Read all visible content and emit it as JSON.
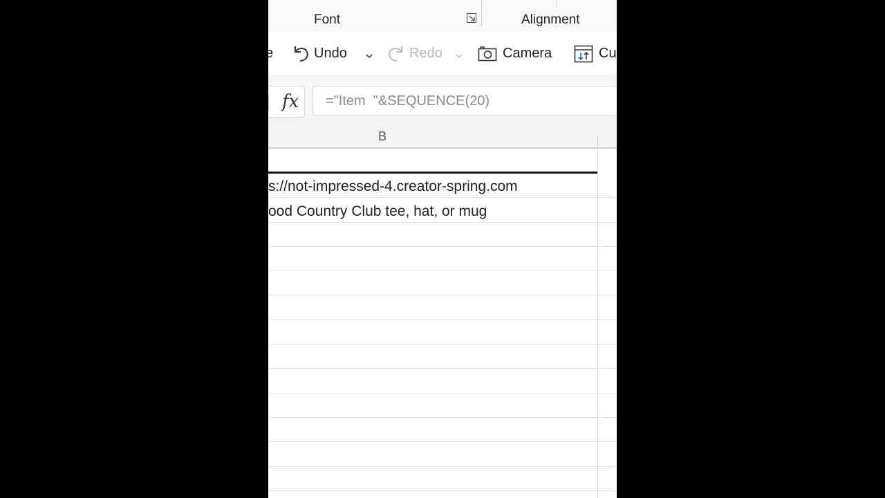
{
  "ribbon": {
    "groups": [
      {
        "label": "Font"
      },
      {
        "label": "Alignment"
      }
    ],
    "icons": {
      "font_launcher": "dialog-launcher-icon"
    }
  },
  "quick_access": {
    "cut_edge_label": "e",
    "undo_label": "Undo",
    "redo_label": "Redo",
    "camera_label": "Camera",
    "custom_label": "Cu",
    "icons": {
      "undo": "undo-icon",
      "redo": "redo-icon",
      "dropdown": "chevron-down-icon",
      "camera": "camera-icon",
      "custom": "custom-view-icon"
    }
  },
  "formula_bar": {
    "fx_label": "fx",
    "formula": "=\"Item  \"&SEQUENCE(20)"
  },
  "sheet": {
    "column_header": "B",
    "rows": [
      {
        "text": ""
      },
      {
        "text": "s://not-impressed-4.creator-spring.com"
      },
      {
        "text": "ood Country Club tee, hat, or mug"
      },
      {
        "text": ""
      },
      {
        "text": ""
      },
      {
        "text": ""
      },
      {
        "text": ""
      },
      {
        "text": ""
      },
      {
        "text": ""
      },
      {
        "text": ""
      },
      {
        "text": ""
      },
      {
        "text": ""
      },
      {
        "text": ""
      },
      {
        "text": ""
      }
    ]
  },
  "colors": {
    "background": "#000000",
    "app_bg": "#ffffff",
    "ribbon_bg": "#f9f9f9",
    "disabled_text": "#b8b8b8",
    "gridline": "#e2e2e2"
  }
}
